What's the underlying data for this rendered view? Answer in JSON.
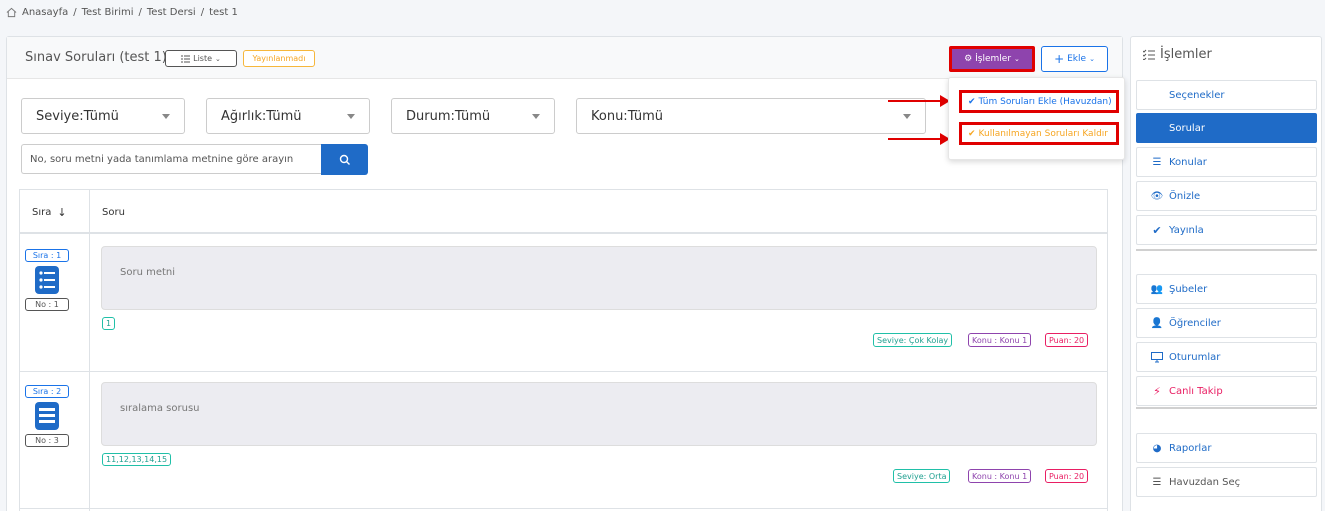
{
  "breadcrumb": [
    "Anasayfa",
    "Test Birimi",
    "Test Dersi",
    "test 1"
  ],
  "breadcrumb_sep": "/",
  "header": {
    "title": "Sınav Soruları (test 1)",
    "liste_label": "Liste",
    "status_badge": "Yayınlanmadı",
    "islemler_label": "İşlemler",
    "ekle_label": "Ekle"
  },
  "filters": {
    "seviye": "Seviye:Tümü",
    "agirlik": "Ağırlık:Tümü",
    "durum": "Durum:Tümü",
    "konu": "Konu:Tümü"
  },
  "search": {
    "placeholder": "No, soru metni yada tanımlama metnine göre arayın"
  },
  "table": {
    "col_sira": "Sıra",
    "col_soru": "Soru",
    "rows": [
      {
        "sira": "Sıra : 1",
        "no": "No : 1",
        "text": "Soru metni",
        "answer": "1",
        "seviye": "Seviye: Çok Kolay",
        "konu": "Konu : Konu 1",
        "puan": "Puan: 20"
      },
      {
        "sira": "Sıra : 2",
        "no": "No : 3",
        "text": "sıralama sorusu",
        "answer": "11,12,13,14,15",
        "seviye": "Seviye: Orta",
        "konu": "Konu : Konu 1",
        "puan": "Puan: 20"
      }
    ]
  },
  "dropdown": {
    "item1": "Tüm Soruları Ekle (Havuzdan)",
    "item2": "Kullanılmayan Soruları Kaldır"
  },
  "sidebar": {
    "title": "İşlemler",
    "items": {
      "secenekler": "Seçenekler",
      "sorular": "Sorular",
      "konular": "Konular",
      "onizle": "Önizle",
      "yayinla": "Yayınla",
      "subeler": "Şubeler",
      "ogrenciler": "Öğrenciler",
      "oturumlar": "Oturumlar",
      "canli_takip": "Canlı Takip",
      "raporlar": "Raporlar",
      "havuzdan_sec": "Havuzdan Seç"
    }
  },
  "colors": {
    "primary": "#1f6bc7",
    "purple": "#8e44ad",
    "highlight": "#e00000",
    "warning": "#f6a623",
    "pink": "#e91e63",
    "teal": "#20a090"
  }
}
